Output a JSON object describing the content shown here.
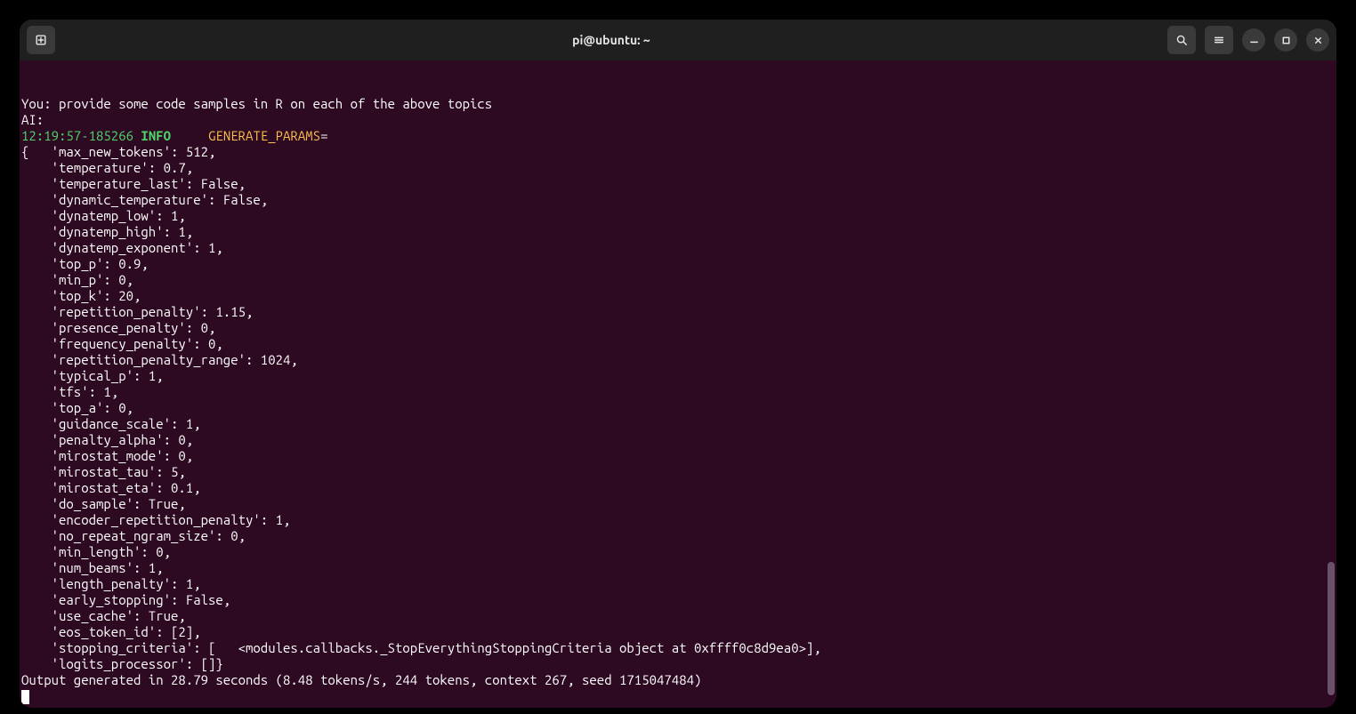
{
  "window": {
    "title": "pi@ubuntu: ~"
  },
  "terminal": {
    "you_line": "You: provide some code samples in R on each of the above topics",
    "ai_line": "AI:",
    "log_timestamp": "12:19:57-185266",
    "log_level": "INFO",
    "log_key": "GENERATE_PARAMS",
    "log_sep": "=",
    "brace_open": "{",
    "params": [
      {
        "k": "max_new_tokens",
        "v": "512"
      },
      {
        "k": "temperature",
        "v": "0.7"
      },
      {
        "k": "temperature_last",
        "v": "False"
      },
      {
        "k": "dynamic_temperature",
        "v": "False"
      },
      {
        "k": "dynatemp_low",
        "v": "1"
      },
      {
        "k": "dynatemp_high",
        "v": "1"
      },
      {
        "k": "dynatemp_exponent",
        "v": "1"
      },
      {
        "k": "top_p",
        "v": "0.9"
      },
      {
        "k": "min_p",
        "v": "0"
      },
      {
        "k": "top_k",
        "v": "20"
      },
      {
        "k": "repetition_penalty",
        "v": "1.15"
      },
      {
        "k": "presence_penalty",
        "v": "0"
      },
      {
        "k": "frequency_penalty",
        "v": "0"
      },
      {
        "k": "repetition_penalty_range",
        "v": "1024"
      },
      {
        "k": "typical_p",
        "v": "1"
      },
      {
        "k": "tfs",
        "v": "1"
      },
      {
        "k": "top_a",
        "v": "0"
      },
      {
        "k": "guidance_scale",
        "v": "1"
      },
      {
        "k": "penalty_alpha",
        "v": "0"
      },
      {
        "k": "mirostat_mode",
        "v": "0"
      },
      {
        "k": "mirostat_tau",
        "v": "5"
      },
      {
        "k": "mirostat_eta",
        "v": "0.1"
      },
      {
        "k": "do_sample",
        "v": "True"
      },
      {
        "k": "encoder_repetition_penalty",
        "v": "1"
      },
      {
        "k": "no_repeat_ngram_size",
        "v": "0"
      },
      {
        "k": "min_length",
        "v": "0"
      },
      {
        "k": "num_beams",
        "v": "1"
      },
      {
        "k": "length_penalty",
        "v": "1"
      },
      {
        "k": "early_stopping",
        "v": "False"
      },
      {
        "k": "use_cache",
        "v": "True"
      },
      {
        "k": "eos_token_id",
        "v": "[2]"
      },
      {
        "k": "stopping_criteria",
        "v": "[   <modules.callbacks._StopEverythingStoppingCriteria object at 0xffff0c8d9ea0>]"
      },
      {
        "k": "logits_processor",
        "v": "[]",
        "last": true
      }
    ],
    "output_line": "Output generated in 28.79 seconds (8.48 tokens/s, 244 tokens, context 267, seed 1715047484)"
  }
}
